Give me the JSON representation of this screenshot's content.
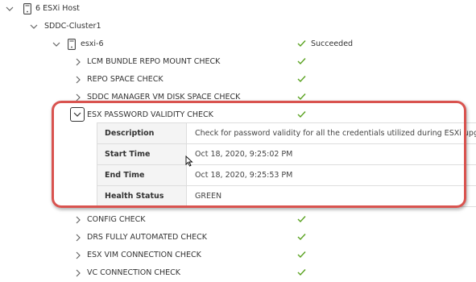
{
  "tree": {
    "host_group": {
      "label": "6 ESXi Host"
    },
    "cluster": {
      "label": "SDDC-Cluster1"
    },
    "host": {
      "label": "esxi-6",
      "status": "Succeeded"
    },
    "checks": [
      {
        "label": "LCM BUNDLE REPO MOUNT CHECK",
        "status": "ok"
      },
      {
        "label": "REPO SPACE CHECK",
        "status": "ok"
      },
      {
        "label": "SDDC MANAGER VM DISK SPACE CHECK",
        "status": "ok"
      },
      {
        "label": "ESX PASSWORD VALIDITY CHECK",
        "status": "ok",
        "expanded": true
      },
      {
        "label": "CONFIG CHECK",
        "status": "ok"
      },
      {
        "label": "DRS FULLY AUTOMATED CHECK",
        "status": "ok"
      },
      {
        "label": "ESX VIM CONNECTION CHECK",
        "status": "ok"
      },
      {
        "label": "VC CONNECTION CHECK",
        "status": "ok"
      }
    ]
  },
  "detail": {
    "rows": [
      {
        "label": "Description",
        "value": "Check for password validity for all the credentials utilized during ESXi upgrade."
      },
      {
        "label": "Start Time",
        "value": "Oct 18, 2020, 9:25:02 PM"
      },
      {
        "label": "End Time",
        "value": "Oct 18, 2020, 9:25:53 PM"
      },
      {
        "label": "Health Status",
        "value": "GREEN"
      }
    ]
  },
  "colors": {
    "success": "#5aa220",
    "highlight": "#d9534f",
    "text": "#333333",
    "label_bg": "#f4f4f4"
  },
  "icons": {
    "chevron_down": "chevron-down-icon",
    "chevron_right": "chevron-right-icon",
    "check": "check-icon",
    "host": "host-icon"
  }
}
